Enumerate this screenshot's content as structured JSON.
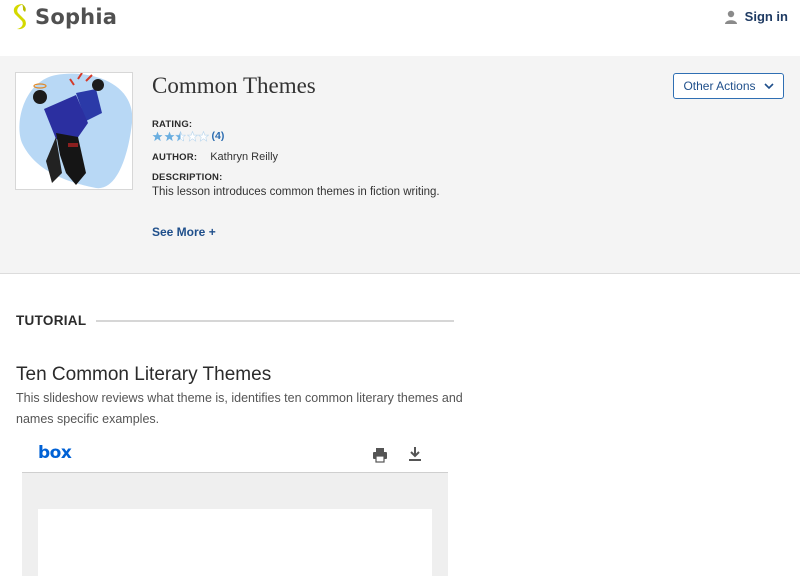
{
  "header": {
    "logo_text": "Sophia",
    "signin_label": "Sign in"
  },
  "lesson": {
    "title": "Common Themes",
    "rating_label": "RATING:",
    "rating_value": 2.5,
    "rating_max": 5,
    "rating_count": "(4)",
    "author_label": "AUTHOR:",
    "author_name": "Kathryn Reilly",
    "description_label": "DESCRIPTION:",
    "description": "This lesson introduces common themes in fiction writing.",
    "see_more": "See More +",
    "other_actions": "Other Actions"
  },
  "tutorial": {
    "section_label": "TUTORIAL",
    "title": "Ten Common Literary Themes",
    "description": "This slideshow reviews what theme is, identifies ten common literary themes and names specific examples."
  },
  "viewer": {
    "logo_text": "box"
  },
  "colors": {
    "star_filled": "#6aaee0",
    "star_empty": "#bcd8ee",
    "accent_blue": "#1f4f8b",
    "banner_bg": "#f4f4f4"
  },
  "icons": {
    "logo": "sophia-logo-mark",
    "signin": "user-icon",
    "dropdown": "chevron-down-icon",
    "print": "print-icon",
    "download": "download-icon"
  }
}
